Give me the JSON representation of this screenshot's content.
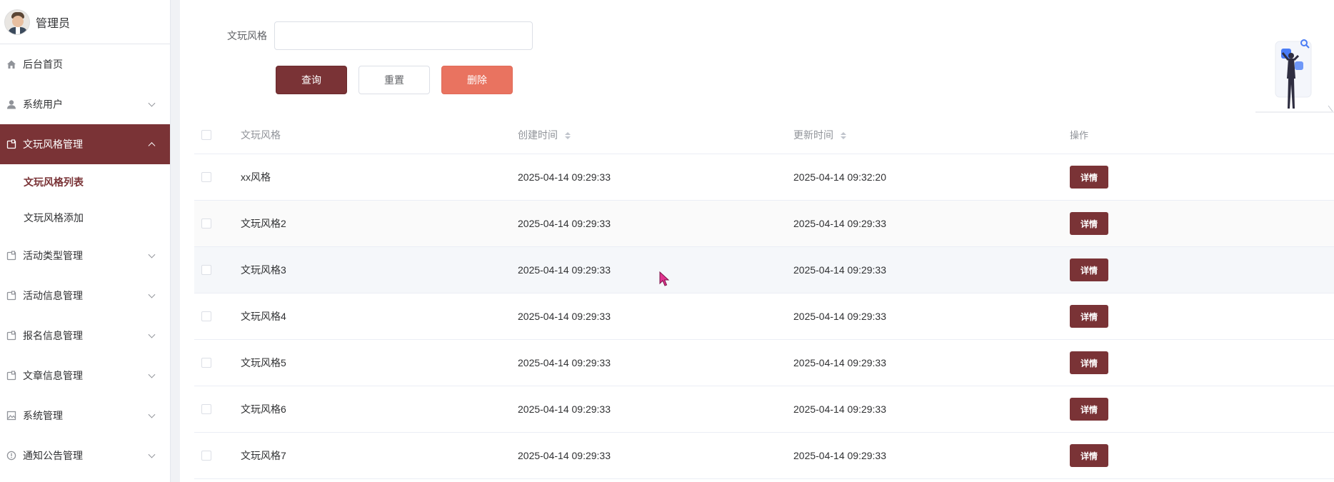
{
  "user": {
    "name": "管理员"
  },
  "sidebar": {
    "items": [
      {
        "label": "后台首页",
        "icon": "home-icon"
      },
      {
        "label": "系统用户",
        "icon": "user-icon"
      },
      {
        "label": "文玩风格管理",
        "icon": "folder-icon",
        "active": true,
        "children": [
          {
            "label": "文玩风格列表",
            "current": true
          },
          {
            "label": "文玩风格添加"
          }
        ]
      },
      {
        "label": "活动类型管理",
        "icon": "folder-icon"
      },
      {
        "label": "活动信息管理",
        "icon": "folder-icon"
      },
      {
        "label": "报名信息管理",
        "icon": "folder-icon"
      },
      {
        "label": "文章信息管理",
        "icon": "folder-icon"
      },
      {
        "label": "系统管理",
        "icon": "image-icon"
      },
      {
        "label": "通知公告管理",
        "icon": "info-circle-icon"
      }
    ]
  },
  "search": {
    "label": "文玩风格",
    "value": "",
    "placeholder": ""
  },
  "buttons": {
    "query": "查询",
    "reset": "重置",
    "delete": "删除"
  },
  "table": {
    "headers": {
      "name": "文玩风格",
      "created": "创建时间",
      "updated": "更新时间",
      "op": "操作"
    },
    "detail_label": "详情",
    "rows": [
      {
        "name": "xx风格",
        "created": "2025-04-14 09:29:33",
        "updated": "2025-04-14 09:32:20"
      },
      {
        "name": "文玩风格2",
        "created": "2025-04-14 09:29:33",
        "updated": "2025-04-14 09:29:33"
      },
      {
        "name": "文玩风格3",
        "created": "2025-04-14 09:29:33",
        "updated": "2025-04-14 09:29:33"
      },
      {
        "name": "文玩风格4",
        "created": "2025-04-14 09:29:33",
        "updated": "2025-04-14 09:29:33"
      },
      {
        "name": "文玩风格5",
        "created": "2025-04-14 09:29:33",
        "updated": "2025-04-14 09:29:33"
      },
      {
        "name": "文玩风格6",
        "created": "2025-04-14 09:29:33",
        "updated": "2025-04-14 09:29:33"
      },
      {
        "name": "文玩风格7",
        "created": "2025-04-14 09:29:33",
        "updated": "2025-04-14 09:29:33"
      }
    ]
  },
  "colors": {
    "primary": "#7a3336",
    "danger": "#e97360"
  }
}
